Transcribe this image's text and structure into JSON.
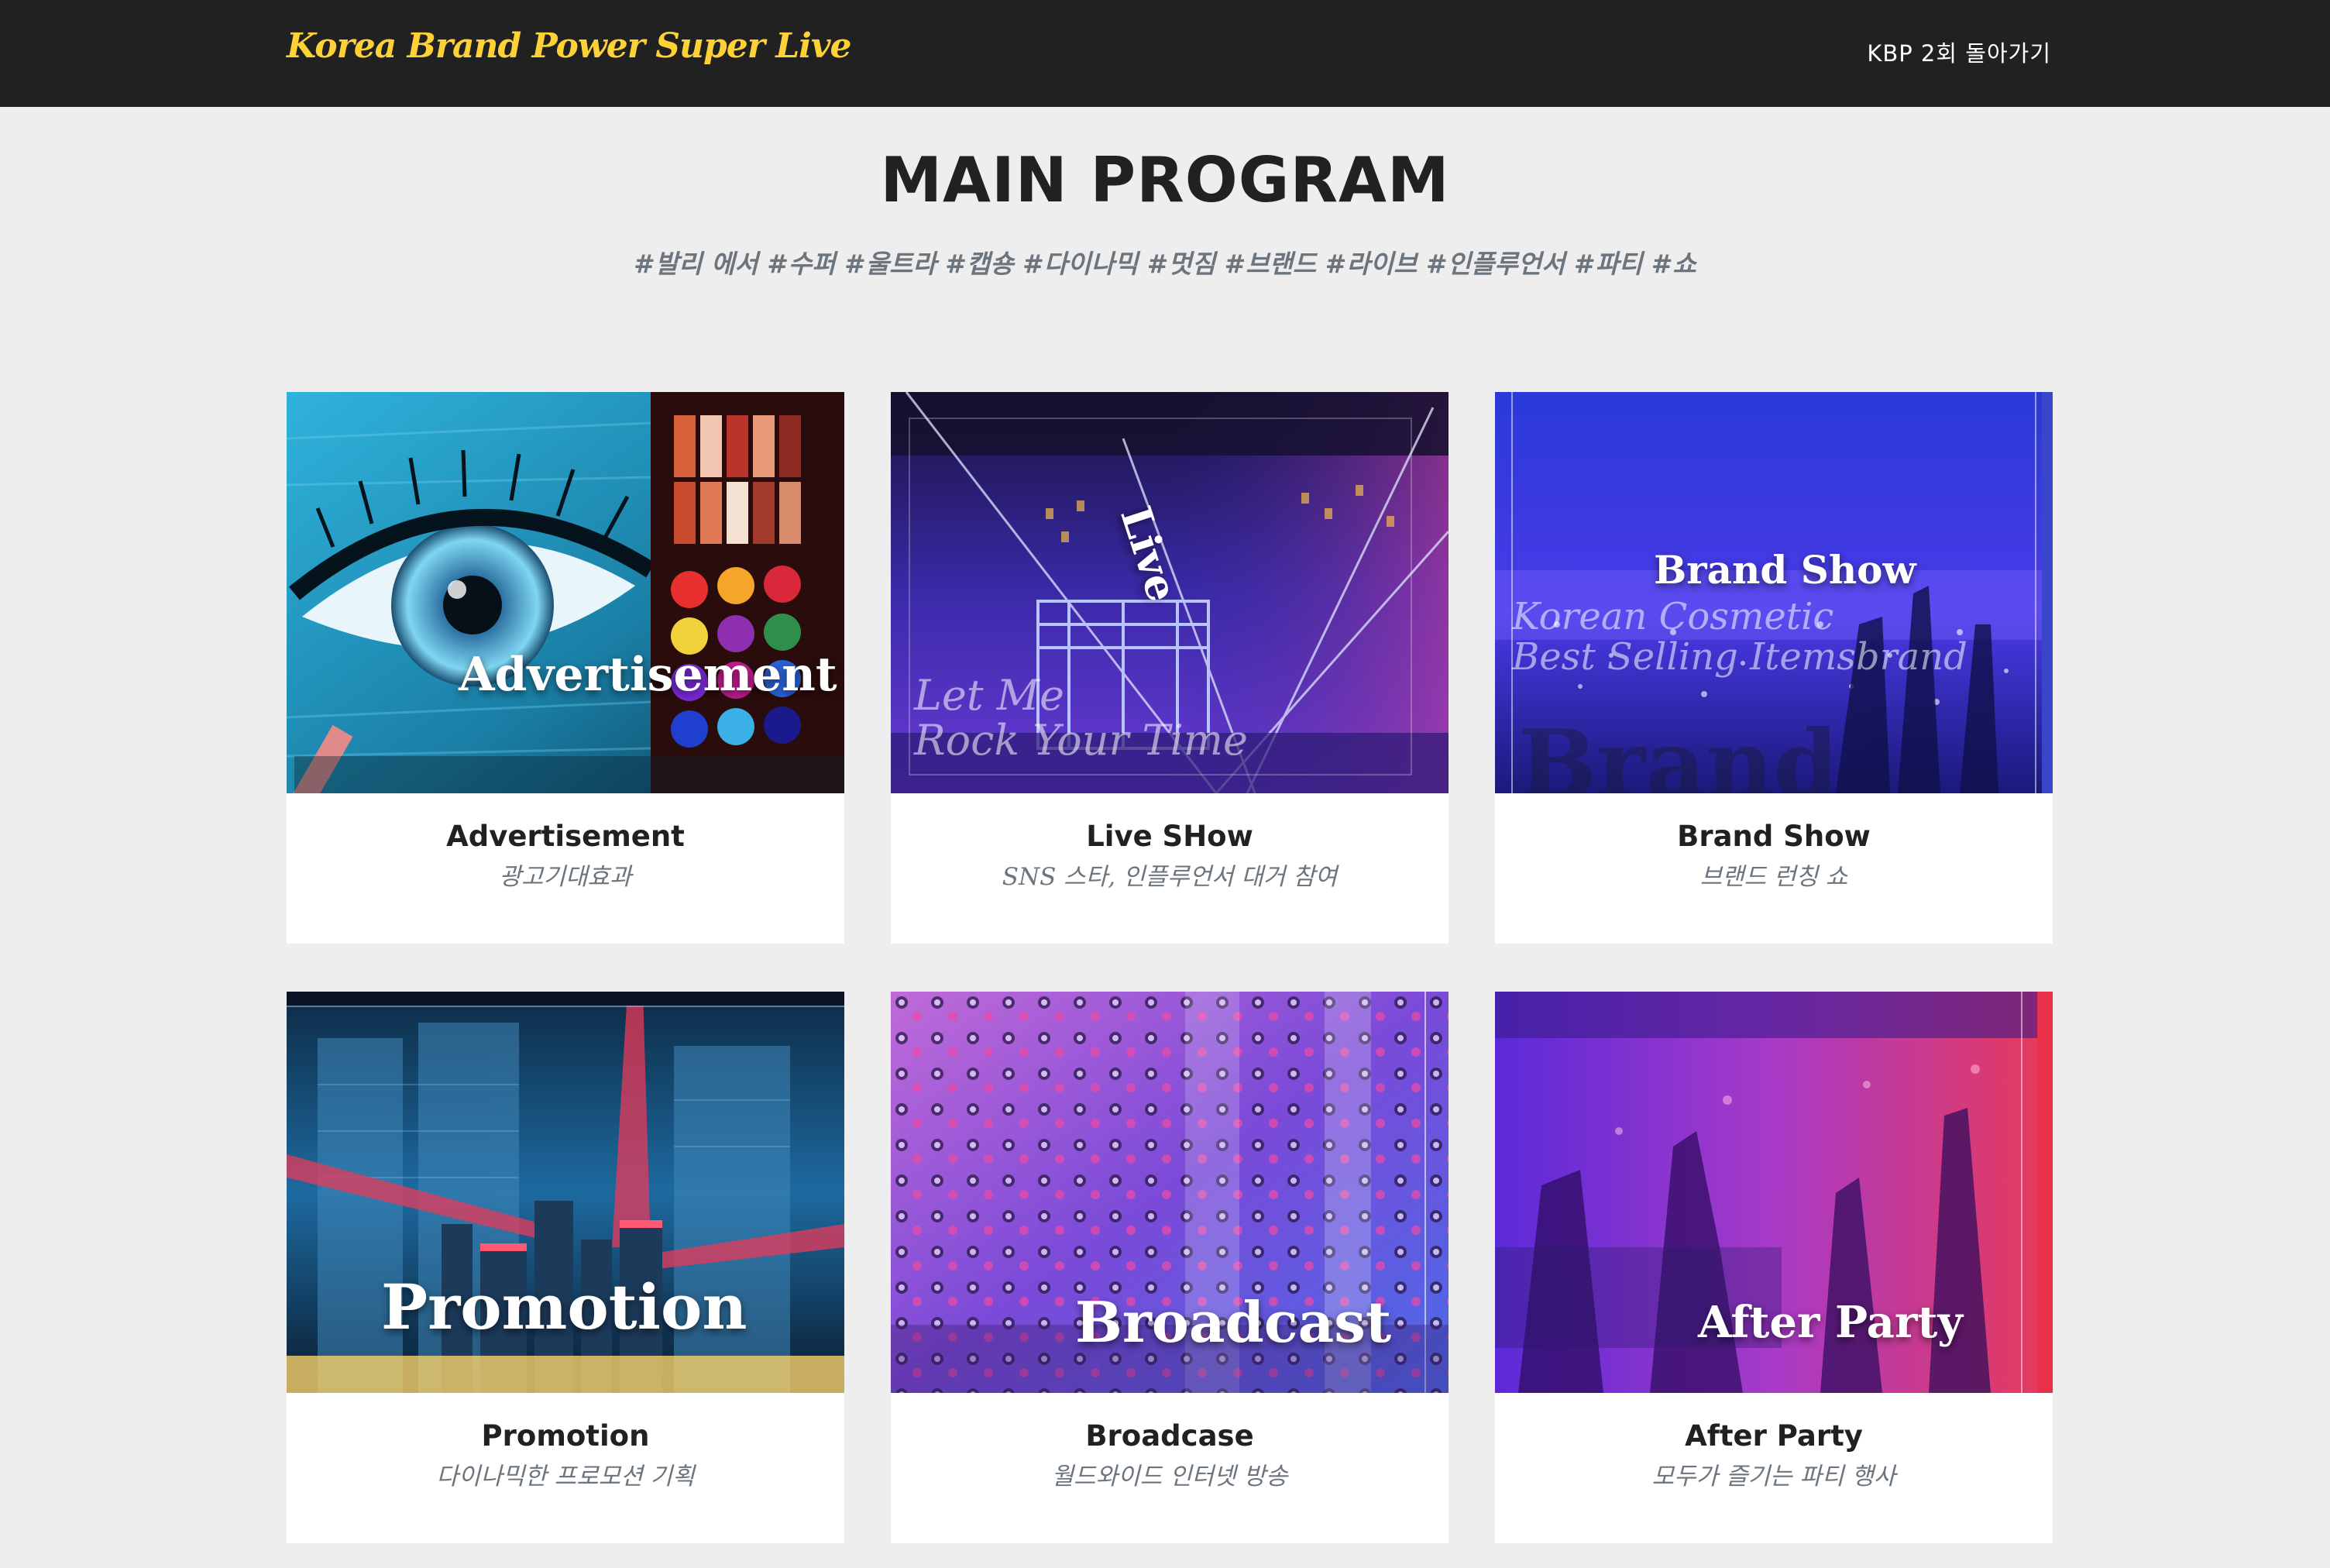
{
  "navbar": {
    "brand": "Korea Brand Power Super Live",
    "link": "KBP 2회 돌아가기"
  },
  "section": {
    "title": "MAIN PROGRAM",
    "subtitle": "#발리 에서 #수퍼 #울트라 #캡숑 #다이나믹 #멋짐 #브랜드 #라이브 #인플루언서 #파티 #쇼"
  },
  "portfolio": [
    {
      "overlay": "Advertisement",
      "title": "Advertisement",
      "subtitle": "광고기대효과"
    },
    {
      "overlay": "Live",
      "overlay_script": [
        "Let Me",
        "Rock Your Time"
      ],
      "title": "Live SHow",
      "subtitle": "SNS 스타, 인플루언서 대거 참여"
    },
    {
      "overlay": "Brand Show",
      "overlay_script": [
        "Korean Cosmetic",
        "Best Selling Itemsbrand"
      ],
      "overlay_big": "Brand",
      "title": "Brand Show",
      "subtitle": "브랜드 런칭 쇼"
    },
    {
      "overlay": "Promotion",
      "title": "Promotion",
      "subtitle": "다이나믹한 프로모션 기획"
    },
    {
      "overlay": "Broadcast",
      "title": "Broadcase",
      "subtitle": "월드와이드 인터넷 방송"
    },
    {
      "overlay": "After Party",
      "title": "After Party",
      "subtitle": "모두가 즐기는 파티 행사"
    }
  ],
  "colors": {
    "navbar_bg": "#212121",
    "brand": "#fed136",
    "page_bg": "#eeeeee",
    "card_bg": "#ffffff",
    "heading": "#212121",
    "muted": "#6c757d"
  }
}
